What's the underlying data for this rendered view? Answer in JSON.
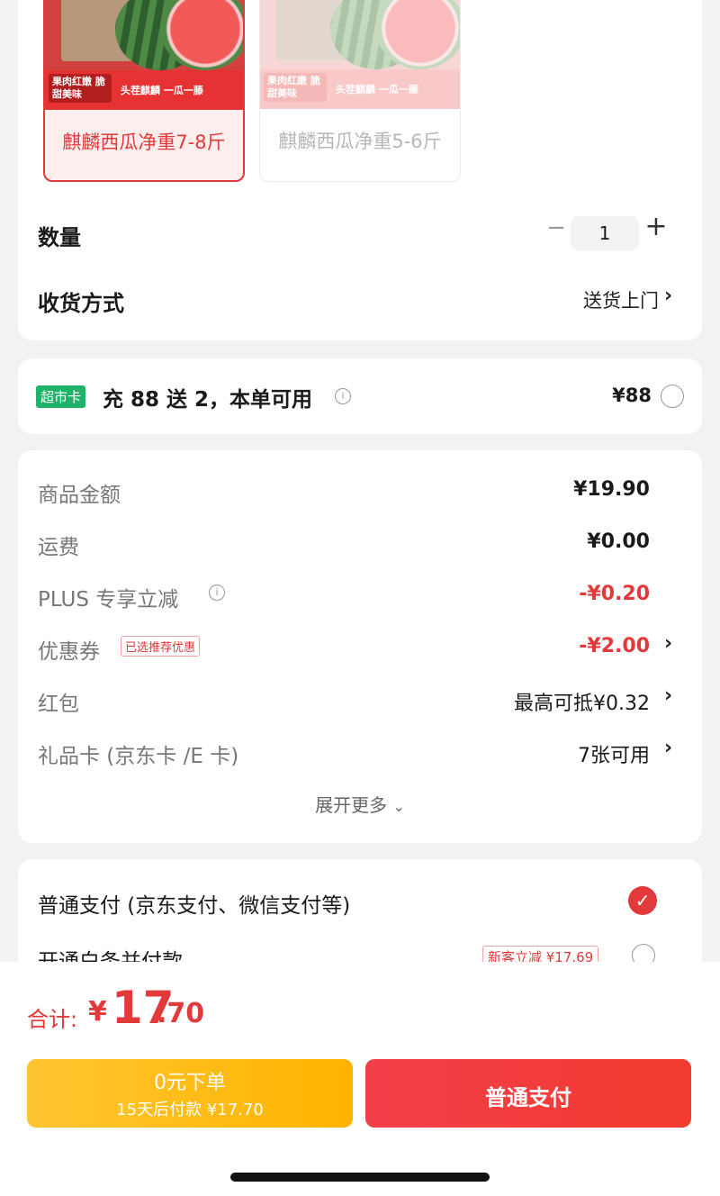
{
  "variants": [
    {
      "name": "麒麟西瓜净重7-8斤",
      "banner_tag": "果肉红嫩 脆甜美味",
      "banner_text": "头茬麒麟 一瓜一藤",
      "selected": true
    },
    {
      "name": "麒麟西瓜净重5-6斤",
      "banner_tag": "果肉红嫩 脆甜美味",
      "banner_text": "头茬麒麟 一瓜一藤",
      "selected": false
    }
  ],
  "quantity": {
    "label": "数量",
    "minus": "−",
    "value": "1",
    "plus": "+"
  },
  "delivery": {
    "label": "收货方式",
    "value": "送货上门"
  },
  "supermarket_card": {
    "tag": "超市卡",
    "promo": "充 88 送 2，本单可用",
    "price": "¥88"
  },
  "price_details": [
    {
      "label": "商品金额",
      "value": "¥19.90",
      "style": "bold"
    },
    {
      "label": "运费",
      "value": "¥0.00",
      "style": "bold"
    },
    {
      "label": "PLUS 专享立减",
      "value": "-¥0.20",
      "style": "red"
    },
    {
      "label": "优惠券",
      "value": "-¥2.00",
      "style": "red",
      "badge": "已选推荐优惠"
    },
    {
      "label": "红包",
      "value": "最高可抵¥0.32",
      "style": "normal"
    },
    {
      "label": "礼品卡 (京东卡 /E 卡)",
      "value": "7张可用",
      "style": "normal"
    }
  ],
  "expand_more": "展开更多",
  "payment": {
    "normal_label": "普通支付 (京东支付、微信支付等)",
    "baitiao_label": "开通白条并付款",
    "baitiao_badge": "新客立减 ¥17.69"
  },
  "total": {
    "label": "合计:",
    "currency": "¥",
    "integer": "17",
    "decimal": ".70"
  },
  "buttons": {
    "yellow_title": "0元下单",
    "yellow_sub": "15天后付款 ¥17.70",
    "red_title": "普通支付"
  },
  "colors": {
    "accent_red": "#e23a3a",
    "green_tag": "#1fb36a",
    "yellow_button": "#ffc531"
  },
  "icons": [
    "info-icon",
    "chevron-right-icon",
    "chevron-down-icon",
    "check-icon",
    "radio-icon"
  ]
}
